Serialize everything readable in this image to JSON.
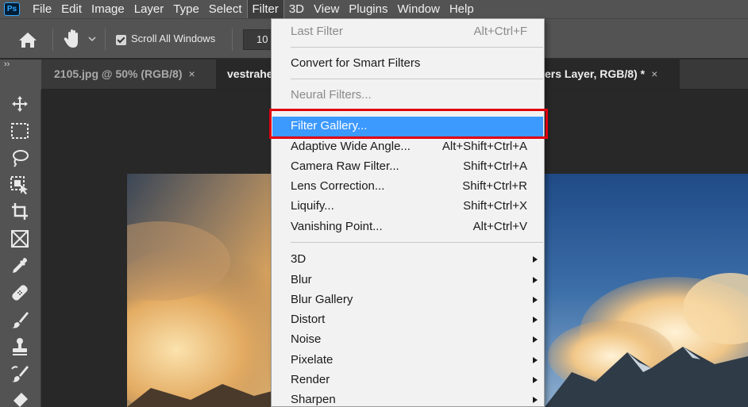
{
  "app": {
    "logo_text": "Ps"
  },
  "menubar": {
    "items": [
      "File",
      "Edit",
      "Image",
      "Layer",
      "Type",
      "Select",
      "Filter",
      "3D",
      "View",
      "Plugins",
      "Window",
      "Help"
    ],
    "active": "Filter"
  },
  "options": {
    "scroll_all_label": "Scroll All Windows",
    "scroll_all_checked": true,
    "zoom_value": "10"
  },
  "tabs": [
    {
      "label": "2105.jpg @ 50% (RGB/8)",
      "close": "×",
      "active": false
    },
    {
      "label": "vestrahe",
      "close": "",
      "active": true
    },
    {
      "label": "ers Layer, RGB/8) *",
      "close": "×",
      "active": true
    }
  ],
  "toolbar": {
    "collapse_glyph": "››"
  },
  "filter_menu": {
    "last_filter": {
      "label": "Last Filter",
      "shortcut": "Alt+Ctrl+F"
    },
    "convert": {
      "label": "Convert for Smart Filters"
    },
    "neural": {
      "label": "Neural Filters..."
    },
    "filter_gallery": {
      "label": "Filter Gallery..."
    },
    "adaptive": {
      "label": "Adaptive Wide Angle...",
      "shortcut": "Alt+Shift+Ctrl+A"
    },
    "camera_raw": {
      "label": "Camera Raw Filter...",
      "shortcut": "Shift+Ctrl+A"
    },
    "lens": {
      "label": "Lens Correction...",
      "shortcut": "Shift+Ctrl+R"
    },
    "liquify": {
      "label": "Liquify...",
      "shortcut": "Shift+Ctrl+X"
    },
    "vanishing": {
      "label": "Vanishing Point...",
      "shortcut": "Alt+Ctrl+V"
    },
    "submenus": [
      "3D",
      "Blur",
      "Blur Gallery",
      "Distort",
      "Noise",
      "Pixelate",
      "Render",
      "Sharpen"
    ]
  },
  "colors": {
    "menu_highlight": "#3c99fe",
    "annotation_box": "#e0000f",
    "ui_dark": "#535353",
    "canvas_bg": "#282828"
  }
}
